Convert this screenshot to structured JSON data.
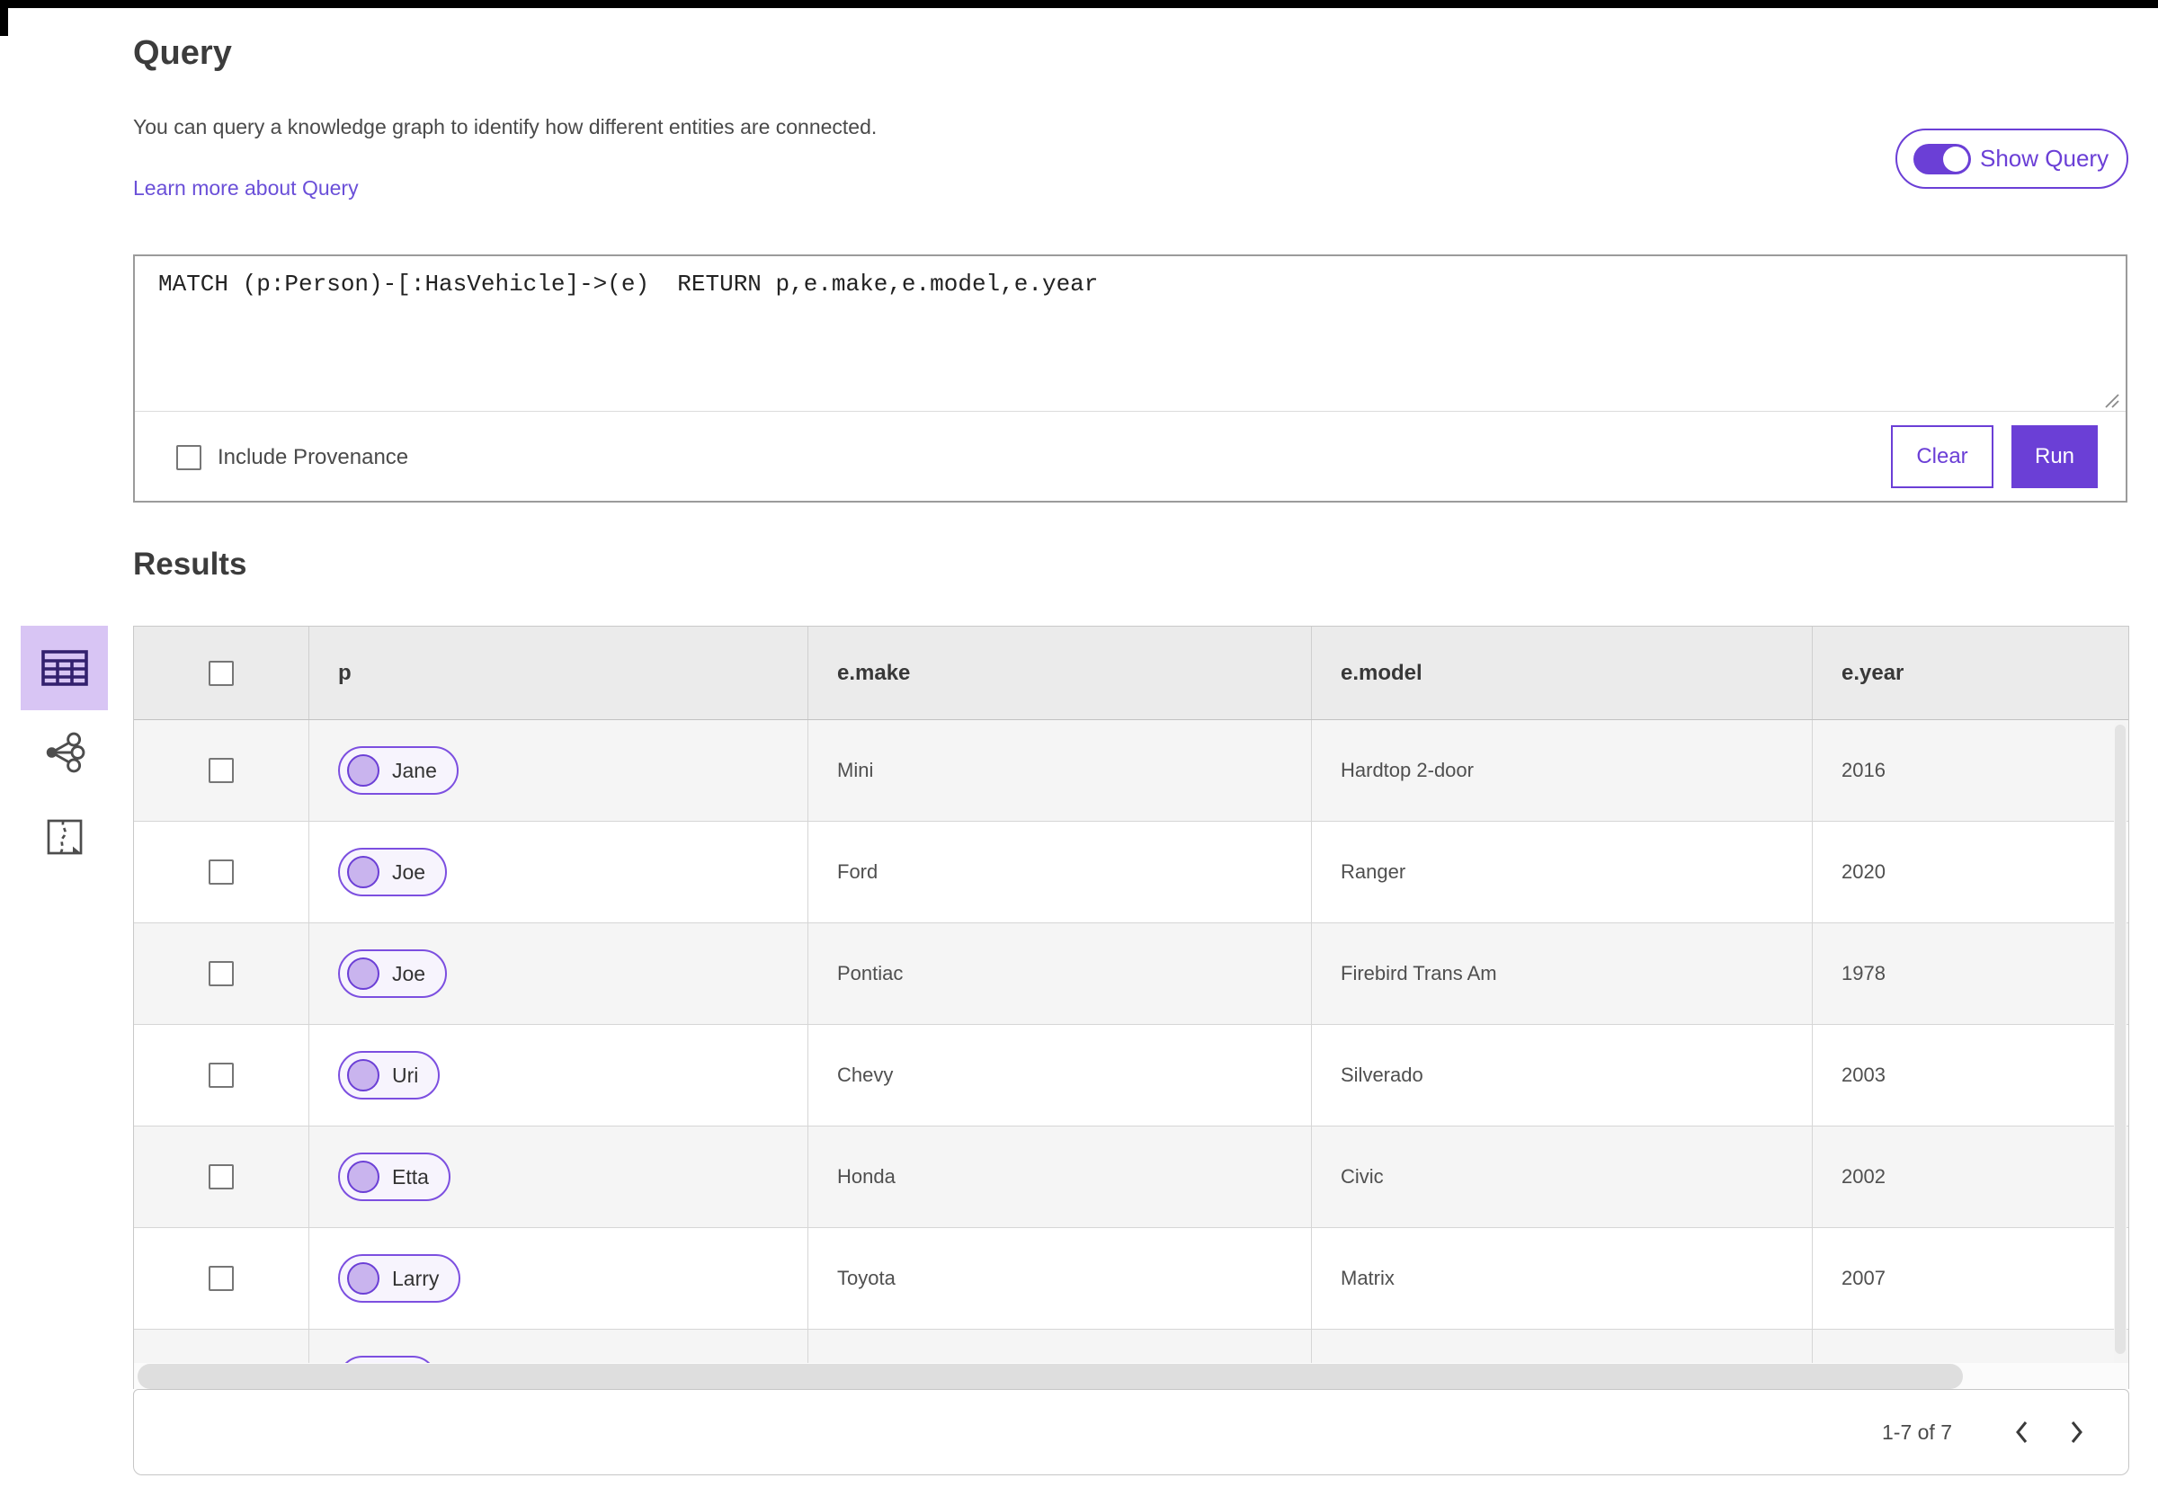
{
  "accent_color": "#6b3fd6",
  "query_section": {
    "title": "Query",
    "description": "You can query a knowledge graph to identify how different entities are connected.",
    "learn_more_label": "Learn more about Query",
    "show_query_label": "Show Query",
    "query_text": "MATCH (p:Person)-[:HasVehicle]->(e)  RETURN p,e.make,e.model,e.year",
    "include_provenance_label": "Include Provenance",
    "include_provenance_checked": false,
    "clear_label": "Clear",
    "run_label": "Run"
  },
  "results_section": {
    "title": "Results",
    "view_switcher": [
      {
        "name": "table-view",
        "selected": true
      },
      {
        "name": "link-chart-view",
        "selected": false
      },
      {
        "name": "map-view",
        "selected": false
      }
    ],
    "table": {
      "columns": {
        "p": "p",
        "make": "e.make",
        "model": "e.model",
        "year": "e.year"
      },
      "rows": [
        {
          "person": "Jane",
          "make": "Mini",
          "model": "Hardtop 2-door",
          "year": "2016"
        },
        {
          "person": "Joe",
          "make": "Ford",
          "model": "Ranger",
          "year": "2020"
        },
        {
          "person": "Joe",
          "make": "Pontiac",
          "model": "Firebird Trans Am",
          "year": "1978"
        },
        {
          "person": "Uri",
          "make": "Chevy",
          "model": "Silverado",
          "year": "2003"
        },
        {
          "person": "Etta",
          "make": "Honda",
          "model": "Civic",
          "year": "2002"
        },
        {
          "person": "Larry",
          "make": "Toyota",
          "model": "Matrix",
          "year": "2007"
        },
        {
          "person": "",
          "make": "",
          "model": "",
          "year": ""
        }
      ]
    },
    "pagination": {
      "range_label": "1-7 of 7"
    }
  }
}
